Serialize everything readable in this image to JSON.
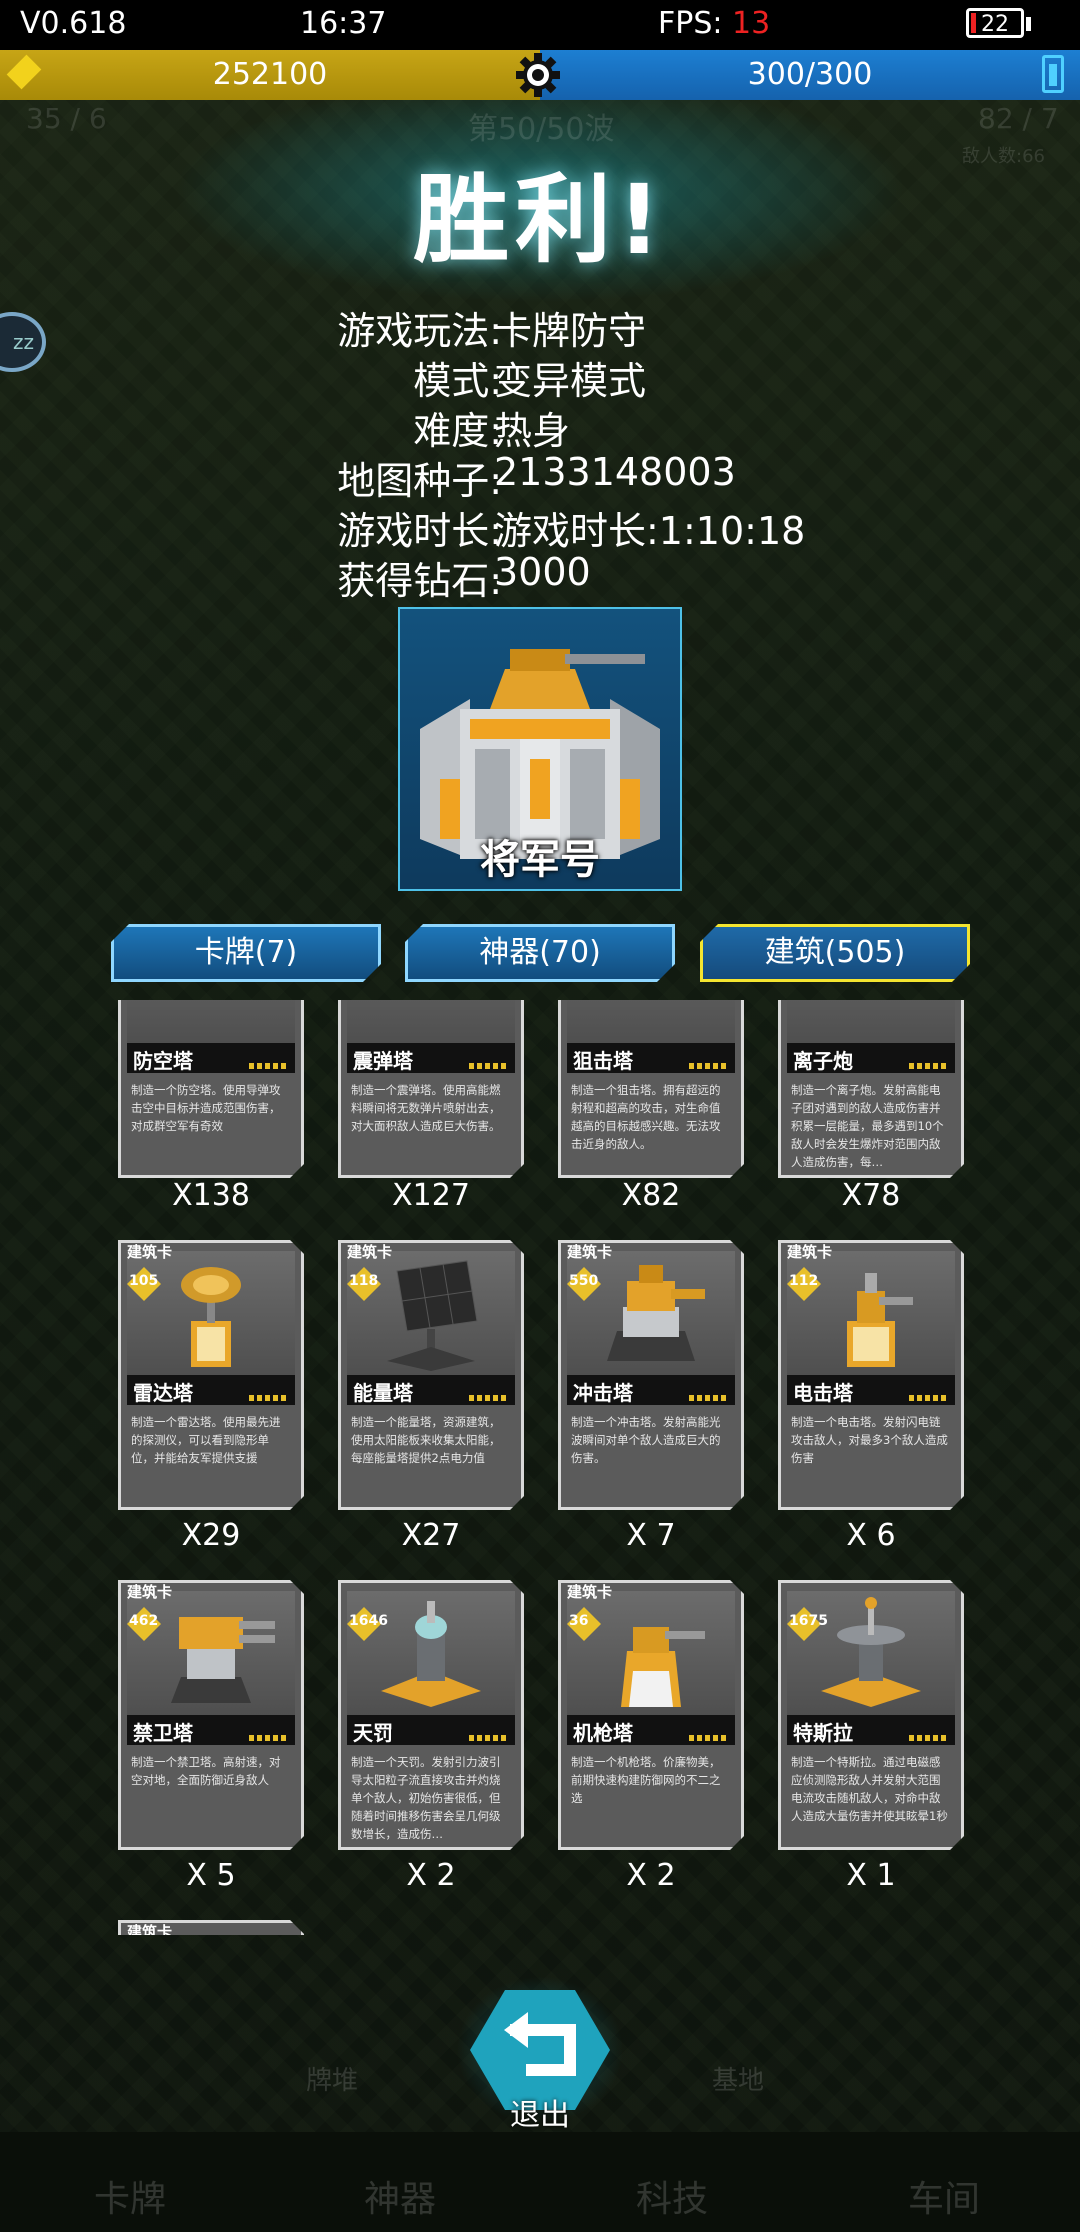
{
  "status_bar": {
    "version": "V0.618",
    "time": "16:37",
    "fps_label": "FPS:",
    "fps_value": "13",
    "battery": "22"
  },
  "resources": {
    "gold": "252100",
    "energy": "300/300"
  },
  "background": {
    "wave": "第50/50波",
    "left_stat": "35 / 6",
    "right_stat": "82 / 7",
    "enemy_count": "敌人数:66",
    "badge": "zz"
  },
  "title": "胜利!",
  "info": [
    {
      "label": "游戏玩法:",
      "value": "卡牌防守"
    },
    {
      "label": "模式:",
      "value": "变异模式"
    },
    {
      "label": "难度:",
      "value": "热身"
    },
    {
      "label": "地图种子:",
      "value": "2133148003"
    },
    {
      "label": "游戏时长:",
      "value": "游戏时长:1:10:18"
    },
    {
      "label": "获得钻石:",
      "value": "3000"
    }
  ],
  "featured": {
    "name": "将军号"
  },
  "tabs": [
    {
      "label": "卡牌(7)"
    },
    {
      "label": "神器(70)"
    },
    {
      "label": "建筑(505)"
    }
  ],
  "cards": [
    {
      "name": "防空塔",
      "desc": "制造一个防空塔。使用导弹攻击空中目标并造成范围伤害，对成群空军有奇效",
      "count": "X138"
    },
    {
      "name": "震弹塔",
      "desc": "制造一个震弹塔。使用高能燃料瞬间将无数弹片喷射出去，对大面积敌人造成巨大伤害。",
      "count": "X127"
    },
    {
      "name": "狙击塔",
      "desc": "制造一个狙击塔。拥有超远的射程和超高的攻击，对生命值越高的目标越感兴趣。无法攻击近身的敌人。",
      "count": "X82"
    },
    {
      "name": "离子炮",
      "desc": "制造一个离子炮。发射高能电子团对遇到的敌人造成伤害并积累一层能量，最多遇到10个敌人时会发生爆炸对范围内敌人造成伤害，每…",
      "count": "X78"
    },
    {
      "tag": "建筑卡",
      "cost": "105",
      "name": "雷达塔",
      "desc": "制造一个雷达塔。使用最先进的探测仪，可以看到隐形单位，并能给友军提供支援",
      "count": "X29"
    },
    {
      "tag": "建筑卡",
      "cost": "118",
      "name": "能量塔",
      "desc": "制造一个能量塔，资源建筑，使用太阳能板来收集太阳能，每座能量塔提供2点电力值",
      "count": "X27"
    },
    {
      "tag": "建筑卡",
      "cost": "550",
      "name": "冲击塔",
      "desc": "制造一个冲击塔。发射高能光波瞬间对单个敌人造成巨大的伤害。",
      "count": "X 7"
    },
    {
      "tag": "建筑卡",
      "cost": "112",
      "name": "电击塔",
      "desc": "制造一个电击塔。发射闪电链攻击敌人，对最多3个敌人造成伤害",
      "count": "X 6"
    },
    {
      "tag": "建筑卡",
      "cost": "462",
      "name": "禁卫塔",
      "desc": "制造一个禁卫塔。高射速，对空对地，全面防御近身敌人",
      "count": "X 5"
    },
    {
      "tag": "",
      "cost": "1646",
      "name": "天罚",
      "desc": "制造一个天罚。发射引力波引导太阳粒子流直接攻击并灼烧单个敌人，初始伤害很低，但随着时间推移伤害会呈几何级数增长，造成伤…",
      "count": "X 2"
    },
    {
      "tag": "建筑卡",
      "cost": "36",
      "name": "机枪塔",
      "desc": "制造一个机枪塔。价廉物美，前期快速构建防御网的不二之选",
      "count": "X 2"
    },
    {
      "tag": "",
      "cost": "1675",
      "name": "特斯拉",
      "desc": "制造一个特斯拉。通过电磁感应侦测隐形敌人并发射大范围电流攻击随机敌人，对命中敌人造成大量伤害并使其眩晕1秒",
      "count": "X 1"
    },
    {
      "tag": "建筑卡"
    }
  ],
  "exit_label": "退出",
  "ghost_buttons": [
    "牌堆",
    "基地"
  ],
  "bottom_nav": [
    "卡牌",
    "神器",
    "科技",
    "车间"
  ],
  "colors": {
    "gold_bar": "#c7a516",
    "energy_bar": "#1d7fd2",
    "active_tab_border": "#f4e530",
    "fps_value": "#e22222",
    "exit_button": "#1fa3bd"
  }
}
